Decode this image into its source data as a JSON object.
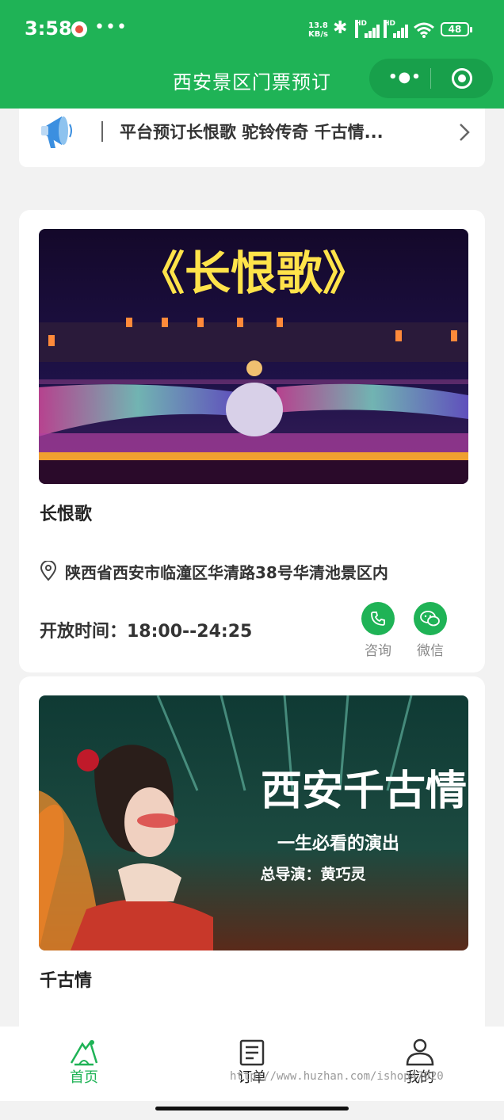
{
  "status_bar": {
    "time": "3:58",
    "more": "•••",
    "net_speed": "13.8",
    "net_unit": "KB/s",
    "signal_tag": "HD",
    "battery": "48"
  },
  "header": {
    "title": "西安景区门票预订",
    "menu_icon": "more-dots-icon",
    "close_icon": "target-icon"
  },
  "notice": {
    "text": "平台预订长恨歌 驼铃传奇 千古情...",
    "icon": "megaphone-icon"
  },
  "cards": [
    {
      "image_title": "《长恨歌》",
      "name": "长恨歌",
      "address": "陕西省西安市临潼区华清路38号华清池景区内",
      "hours": "开放时间：18:00--24:25",
      "actions": [
        {
          "label": "咨询",
          "icon": "phone-icon"
        },
        {
          "label": "微信",
          "icon": "wechat-icon"
        }
      ]
    },
    {
      "image_title": "西安千古情",
      "image_subtitle": "一生必看的演出",
      "image_director": "总导演：黄巧灵",
      "name": "千古情"
    }
  ],
  "tabbar": [
    {
      "label": "首页",
      "icon": "scenic-home-icon",
      "active": true
    },
    {
      "label": "订单",
      "icon": "order-icon",
      "active": false
    },
    {
      "label": "我的",
      "icon": "user-icon",
      "active": false
    }
  ],
  "watermark": "http://www.huzhan.com/ishop47020",
  "colors": {
    "brand": "#1fb356",
    "background": "#f2f2f2"
  }
}
